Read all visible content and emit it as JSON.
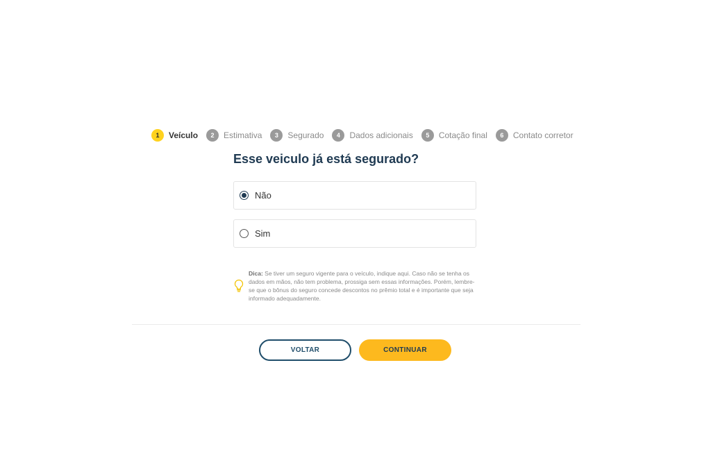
{
  "stepper": {
    "steps": [
      {
        "number": "1",
        "label": "Veículo",
        "active": true
      },
      {
        "number": "2",
        "label": "Estimativa",
        "active": false
      },
      {
        "number": "3",
        "label": "Segurado",
        "active": false
      },
      {
        "number": "4",
        "label": "Dados adicionais",
        "active": false
      },
      {
        "number": "5",
        "label": "Cotação final",
        "active": false
      },
      {
        "number": "6",
        "label": "Contato corretor",
        "active": false
      }
    ]
  },
  "question": {
    "title": "Esse veiculo já está segurado?"
  },
  "options": [
    {
      "label": "Não",
      "selected": true
    },
    {
      "label": "Sim",
      "selected": false
    }
  ],
  "tip": {
    "icon": "lightbulb-icon",
    "prefix": "Dica:",
    "text": " Se tiver um seguro vigente para o veículo, indique aqui. Caso não se tenha os dados em mãos, não tem problema, prossiga sem essas informações. Porém, lembre-se que o bônus do seguro concede descontos no prêmio total e é importante que seja informado adequadamente."
  },
  "buttons": {
    "back_label": "VOLTAR",
    "next_label": "CONTINUAR"
  },
  "colors": {
    "accent": "#fdb91e",
    "active_step": "#ffd21f",
    "primary_dark": "#1f3a52",
    "inactive_step": "#9a9a9a"
  }
}
